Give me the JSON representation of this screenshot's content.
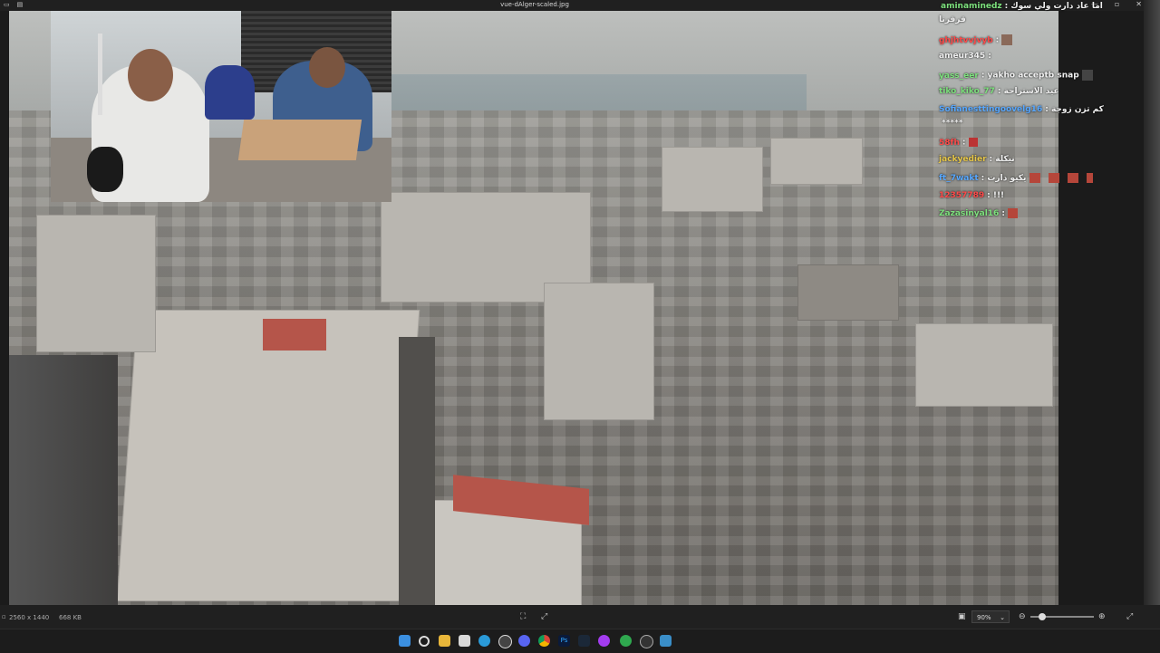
{
  "window": {
    "title": "vue-dAlger-scaled.jpg",
    "controls": [
      "minimize",
      "maximize",
      "close"
    ]
  },
  "chat": [
    {
      "user": "aminaminedz",
      "text": ": اما عاد دارت ولي سوك",
      "color": "#7de07d"
    },
    {
      "user": "",
      "text": "قرقرنا",
      "color": "#e0e0e0"
    },
    {
      "user": "ghjhtvvjvyb",
      "text": ":",
      "color": "#ff4a4a"
    },
    {
      "user": "ameur345",
      "text": ":",
      "color": "#e0e0e0"
    },
    {
      "user": "yass_eer",
      "text": ": yakho acceptb snap",
      "color": "#7de07d"
    },
    {
      "user": "tiko_kiko_77",
      "text": ": عيد الاستراحة",
      "color": "#7de07d"
    },
    {
      "user": "Sofianesttingoovelg16",
      "text": ": كم تزن زوجة",
      "color": "#58a8ff"
    },
    {
      "user": "",
      "text": "*****",
      "color": "#e0e0e0"
    },
    {
      "user": "58fh",
      "text": ":",
      "color": "#ff4a4a"
    },
    {
      "user": "jackyedier",
      "text": ": نيكلة",
      "color": "#e8c84a"
    },
    {
      "user": "ft_7wakt",
      "text": ": يكيو دارت",
      "color": "#58a8ff"
    },
    {
      "user": "12357789",
      "text": ": !!!",
      "color": "#ff4a4a"
    },
    {
      "user": "Zazasinyal16",
      "text": ":",
      "color": "#7de07d"
    }
  ],
  "status": {
    "dimensions": "2560 x 1440",
    "filesize": "668 KB",
    "zoom": "90%"
  },
  "taskbar": {
    "apps": [
      "windows-start",
      "search",
      "file-explorer",
      "store",
      "edge",
      "obs",
      "discord",
      "chrome",
      "photoshop",
      "steam",
      "messenger",
      "xbox",
      "media",
      "photos"
    ]
  }
}
